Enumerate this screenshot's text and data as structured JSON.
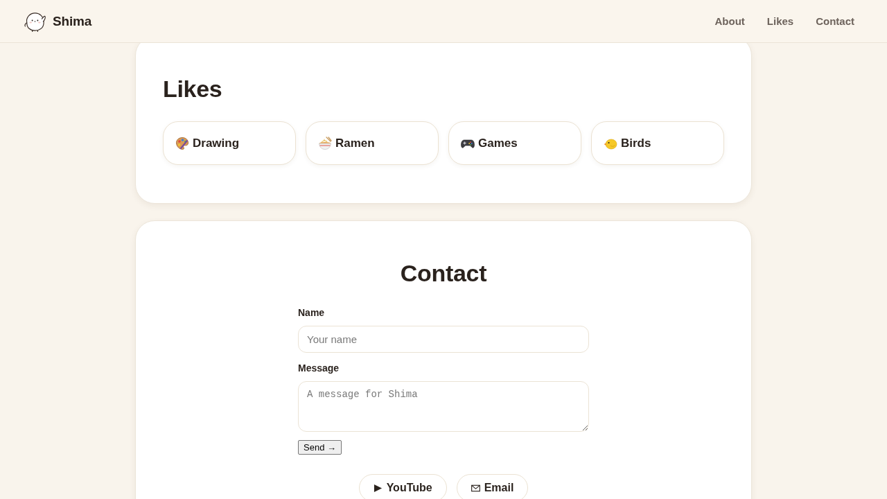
{
  "header": {
    "brand": "Shima",
    "nav": [
      {
        "label": "About"
      },
      {
        "label": "Likes"
      },
      {
        "label": "Contact"
      }
    ]
  },
  "likes": {
    "title": "Likes",
    "items": [
      {
        "label": "Drawing"
      },
      {
        "label": "Ramen"
      },
      {
        "label": "Games"
      },
      {
        "label": "Birds"
      }
    ]
  },
  "contact": {
    "title": "Contact",
    "fields": [
      {
        "kind": "input",
        "label": "Name",
        "placeholder": "Your name"
      },
      {
        "kind": "textarea",
        "label": "Message",
        "placeholder": "A message for Shima"
      }
    ],
    "submit": "Send →",
    "links": [
      {
        "label": "YouTube"
      },
      {
        "label": "Email"
      }
    ]
  }
}
